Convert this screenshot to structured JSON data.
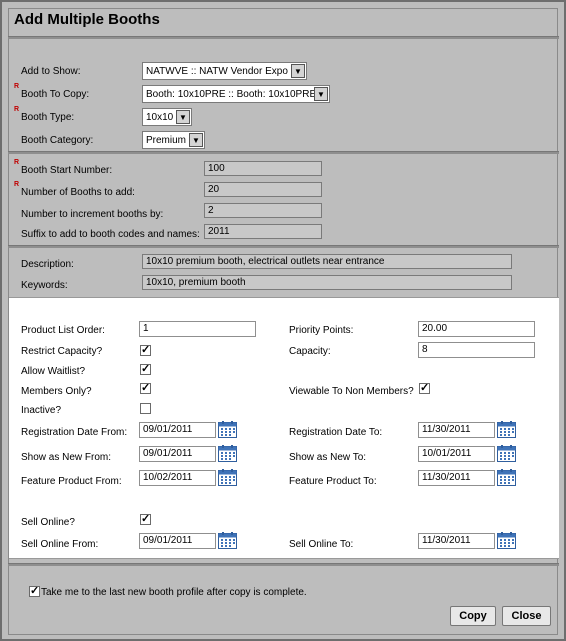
{
  "title": "Add Multiple Booths",
  "section1": {
    "add_to_show_label": "Add to Show:",
    "add_to_show_value": "NATWVE :: NATW Vendor Expo",
    "booth_to_copy_label": "Booth To Copy:",
    "booth_to_copy_value": "Booth: 10x10PRE :: Booth: 10x10PRE",
    "booth_type_label": "Booth Type:",
    "booth_type_value": "10x10",
    "booth_category_label": "Booth Category:",
    "booth_category_value": "Premium",
    "required_marker": "R"
  },
  "section2": {
    "start_number_label": "Booth Start Number:",
    "start_number_value": "100",
    "num_booths_label": "Number of Booths to add:",
    "num_booths_value": "20",
    "increment_label": "Number to increment booths by:",
    "increment_value": "2",
    "suffix_label": "Suffix to add to booth codes and names:",
    "suffix_value": "2011"
  },
  "section3": {
    "description_label": "Description:",
    "description_value": "10x10 premium booth, electrical outlets near entrance",
    "keywords_label": "Keywords:",
    "keywords_value": "10x10, premium booth"
  },
  "details": {
    "product_list_order_label": "Product List Order:",
    "product_list_order_value": "1",
    "priority_points_label": "Priority Points:",
    "priority_points_value": "20.00",
    "restrict_capacity_label": "Restrict Capacity?",
    "capacity_label": "Capacity:",
    "capacity_value": "8",
    "allow_waitlist_label": "Allow Waitlist?",
    "members_only_label": "Members Only?",
    "viewable_label": "Viewable To Non Members?",
    "inactive_label": "Inactive?",
    "reg_from_label": "Registration Date From:",
    "reg_from_value": "09/01/2011",
    "reg_to_label": "Registration Date To:",
    "reg_to_value": "11/30/2011",
    "new_from_label": "Show as New From:",
    "new_from_value": "09/01/2011",
    "new_to_label": "Show as New To:",
    "new_to_value": "10/01/2011",
    "feature_from_label": "Feature Product From:",
    "feature_from_value": "10/02/2011",
    "feature_to_label": "Feature Product To:",
    "feature_to_value": "11/30/2011",
    "sell_online_label": "Sell Online?",
    "sell_from_label": "Sell Online From:",
    "sell_from_value": "09/01/2011",
    "sell_to_label": "Sell Online To:",
    "sell_to_value": "11/30/2011"
  },
  "footer": {
    "take_me_label": "Take me to the last new booth profile after copy is complete.",
    "copy_label": "Copy",
    "close_label": "Close"
  },
  "check_mark": "✓"
}
